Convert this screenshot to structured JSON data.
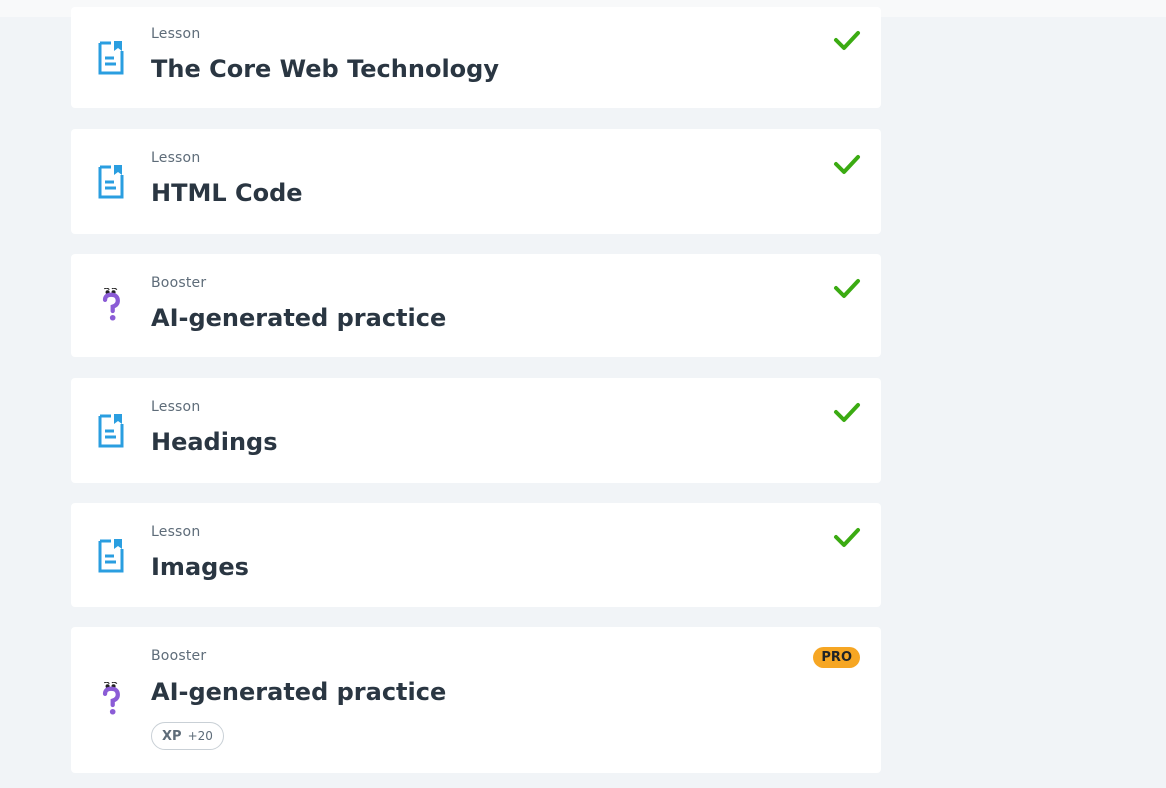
{
  "colors": {
    "page_bg": "#f1f4f7",
    "card_bg": "#ffffff",
    "lesson_icon": "#2a9ee0",
    "booster_icon": "#8b5cd6",
    "check": "#3bab12",
    "pro_badge": "#f6a623",
    "title_text": "#2a3642",
    "type_text": "#5e6c79"
  },
  "items": [
    {
      "type": "Lesson",
      "title": "The Core Web Technology",
      "icon": "document-bookmark-icon",
      "completed": true
    },
    {
      "type": "Lesson",
      "title": "HTML Code",
      "icon": "document-bookmark-icon",
      "completed": true
    },
    {
      "type": "Booster",
      "title": "AI-generated practice",
      "icon": "question-mark-character-icon",
      "completed": true
    },
    {
      "type": "Lesson",
      "title": "Headings",
      "icon": "document-bookmark-icon",
      "completed": true
    },
    {
      "type": "Lesson",
      "title": "Images",
      "icon": "document-bookmark-icon",
      "completed": true
    },
    {
      "type": "Booster",
      "title": "AI-generated practice",
      "icon": "question-mark-character-icon",
      "completed": false,
      "badge": "PRO",
      "xp_label": "XP",
      "xp_value": "+20"
    }
  ]
}
